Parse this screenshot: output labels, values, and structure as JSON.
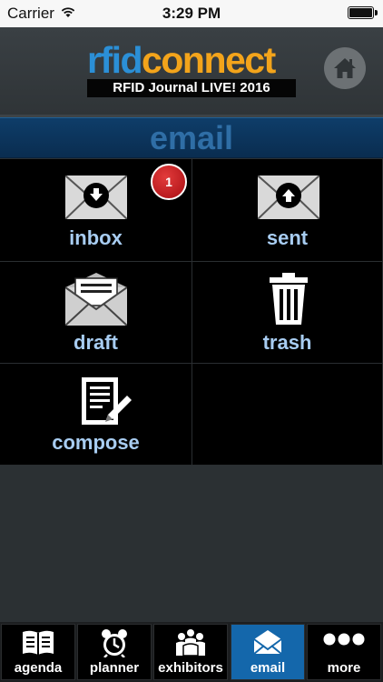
{
  "status_bar": {
    "carrier": "Carrier",
    "time": "3:29 PM"
  },
  "header": {
    "logo_part1": "rfid",
    "logo_part2": "connect",
    "tagline": "RFID Journal LIVE! 2016",
    "brand_colors": {
      "rfid": "#2b8fd6",
      "connect": "#f3a41b"
    },
    "home_icon": "home-icon"
  },
  "section": {
    "title": "email"
  },
  "grid": {
    "items": [
      {
        "label": "inbox",
        "icon": "envelope-download-icon",
        "badge": "1"
      },
      {
        "label": "sent",
        "icon": "envelope-upload-icon"
      },
      {
        "label": "draft",
        "icon": "envelope-letter-icon"
      },
      {
        "label": "trash",
        "icon": "trash-icon"
      },
      {
        "label": "compose",
        "icon": "compose-icon"
      }
    ]
  },
  "tabs": [
    {
      "label": "agenda",
      "icon": "agenda-icon"
    },
    {
      "label": "planner",
      "icon": "alarm-clock-icon"
    },
    {
      "label": "exhibitors",
      "icon": "people-icon"
    },
    {
      "label": "email",
      "icon": "envelope-icon",
      "active": true
    },
    {
      "label": "more",
      "icon": "more-dots-icon"
    }
  ],
  "colors": {
    "active_tab": "#1467ab",
    "label_blue": "#a8cdf2",
    "badge_red": "#c4161c"
  }
}
